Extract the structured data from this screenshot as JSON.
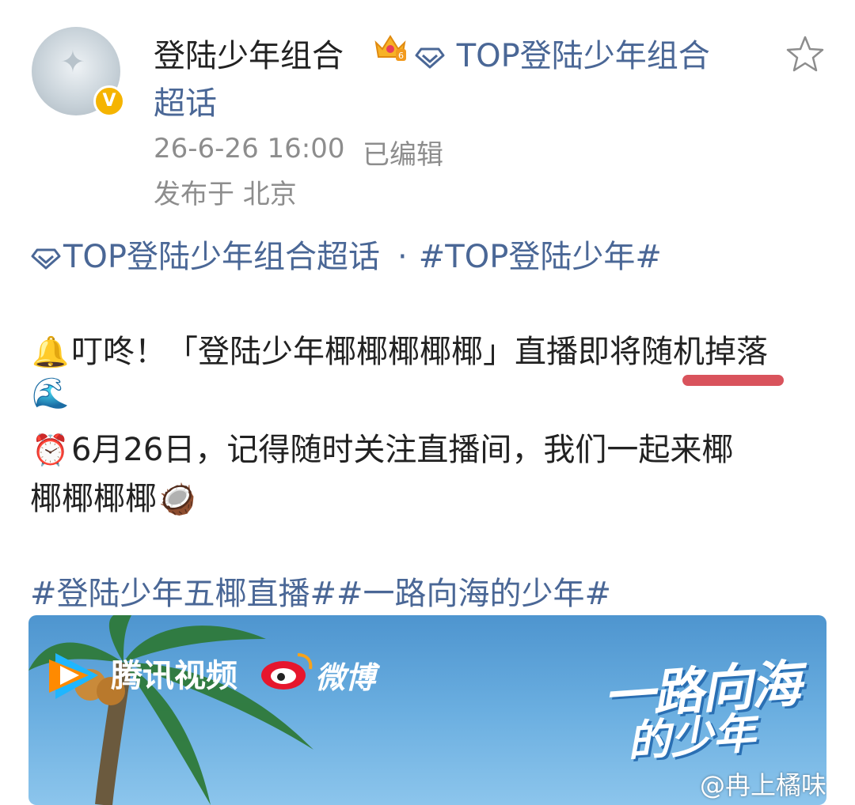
{
  "post": {
    "author": "登陆少年组合",
    "supertopic_prefix": "TOP登陆少年组合",
    "supertopic_suffix": "超话",
    "timestamp": "26-6-26 16:00",
    "edited": "已编辑",
    "location": "发布于 北京",
    "topic_supertopic": "TOP登陆少年组合超话",
    "topic_dot": "·",
    "topic_hashtag": "#TOP登陆少年#",
    "line1": "叮咚！「登陆少年椰椰椰椰椰」直播即将随机掉落",
    "line3": "6月26日，记得随时关注直播间，我们一起来椰",
    "line4": "椰椰椰椰",
    "hashtags": "#登陆少年五椰直播##一路向海的少年#"
  },
  "icons": {
    "verified": "verified-badge-icon",
    "crown": "crown-level-icon",
    "crown_level": "6",
    "gem": "diamond-icon",
    "favorite": "star-icon",
    "bell": "🔔",
    "wave": "🌊",
    "alarm": "⏰",
    "coconut": "🥥"
  },
  "poster": {
    "tencent_label": "腾讯视频",
    "weibo_label": "微博",
    "show_title_line1": "一路向海",
    "show_title_line2": "的少年",
    "watermark": "@冉上橘味"
  },
  "colors": {
    "link": "#4a6796",
    "meta": "#8d8d8d",
    "underline": "#d9535c",
    "badge": "#f5b400"
  }
}
